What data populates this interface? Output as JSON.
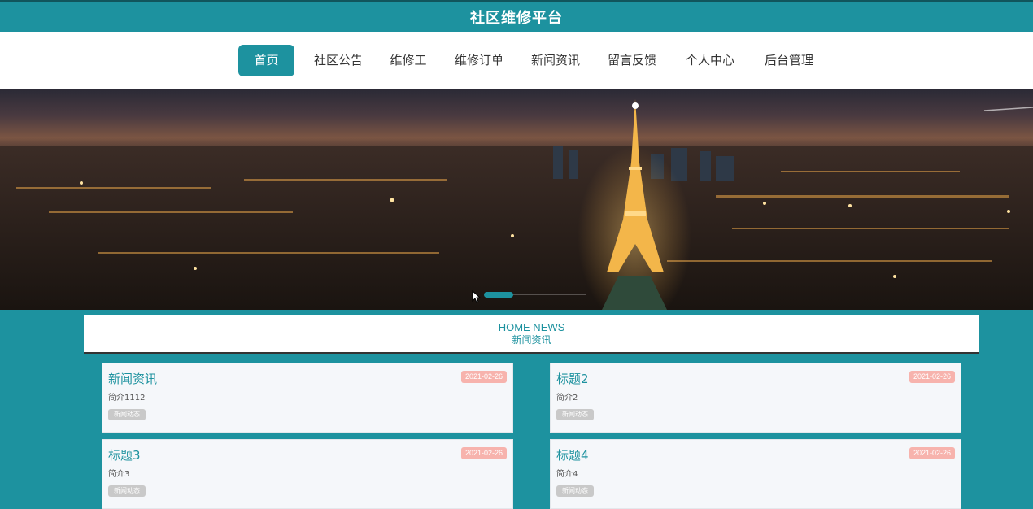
{
  "header": {
    "title": "社区维修平台"
  },
  "nav": {
    "items": [
      {
        "label": "首页",
        "active": true
      },
      {
        "label": "社区公告",
        "active": false
      },
      {
        "label": "维修工",
        "active": false
      },
      {
        "label": "维修订单",
        "active": false
      },
      {
        "label": "新闻资讯",
        "active": false
      },
      {
        "label": "留言反馈",
        "active": false
      },
      {
        "label": "个人中心",
        "active": false
      },
      {
        "label": "后台管理",
        "active": false
      }
    ]
  },
  "carousel": {
    "image": "paris-eiffel-tower-night-cityscape"
  },
  "news_section": {
    "title_en": "HOME NEWS",
    "title_cn": "新闻资讯",
    "cards": [
      {
        "title": "新闻资讯",
        "date": "2021-02-26",
        "desc": "简介1112",
        "tag": "新闻动态"
      },
      {
        "title": "标题2",
        "date": "2021-02-26",
        "desc": "简介2",
        "tag": "新闻动态"
      },
      {
        "title": "标题3",
        "date": "2021-02-26",
        "desc": "简介3",
        "tag": "新闻动态"
      },
      {
        "title": "标题4",
        "date": "2021-02-26",
        "desc": "简介4",
        "tag": "新闻动态"
      }
    ]
  },
  "colors": {
    "accent": "#1d929f",
    "date_badge": "#f7b3ad",
    "tag_badge": "#c9c9c9"
  }
}
